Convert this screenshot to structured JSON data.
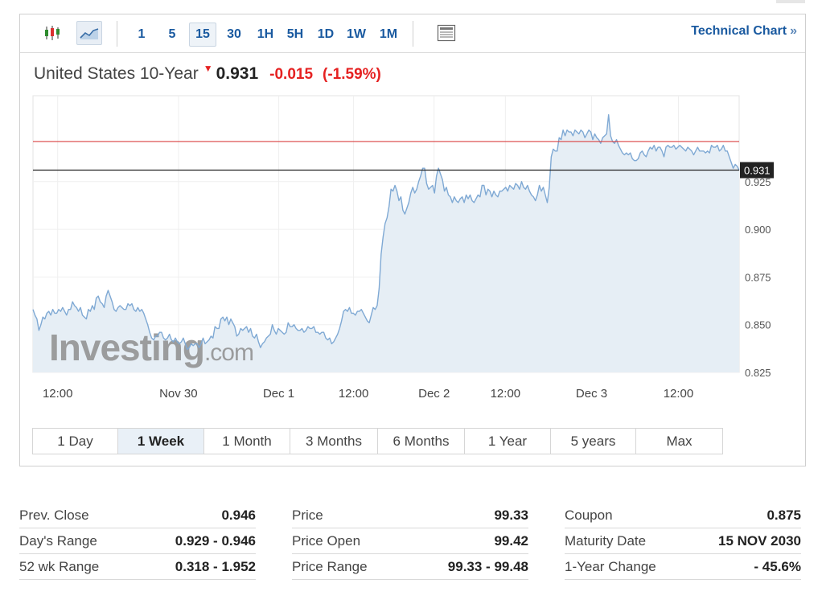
{
  "toolbar": {
    "chart_type_icons": [
      "candlestick-icon",
      "area-chart-icon"
    ],
    "intervals": [
      "1",
      "5",
      "15",
      "30",
      "1H",
      "5H",
      "1D",
      "1W",
      "1M"
    ],
    "active_interval": "15",
    "technical_chart_label": "Technical Chart",
    "technical_chart_arrow": "»"
  },
  "quote": {
    "name": "United States 10-Year",
    "direction_glyph": "▼",
    "last": "0.931",
    "change": "-0.015",
    "change_pct": "(-1.59%)"
  },
  "watermark": {
    "brand": "Investing",
    "suffix": ".com"
  },
  "chart_data": {
    "type": "area",
    "ylim": [
      0.825,
      0.97
    ],
    "y_ticks": [
      "0.825",
      "0.850",
      "0.875",
      "0.900",
      "0.925"
    ],
    "x_tick_labels": [
      "12:00",
      "Nov 30",
      "Dec 1",
      "12:00",
      "Dec 2",
      "12:00",
      "Dec 3",
      "12:00"
    ],
    "x_tick_positions": [
      0.035,
      0.206,
      0.348,
      0.454,
      0.568,
      0.669,
      0.791,
      0.914
    ],
    "prev_close": 0.946,
    "last_price": 0.931,
    "last_price_label": "0.931",
    "line_color": "#7fa9d4",
    "fill_color": "#e6eef5",
    "prev_close_color": "#d94040",
    "last_line_color": "#222222",
    "series": [
      {
        "values": [
          0.858,
          0.855,
          0.853,
          0.847,
          0.85,
          0.854,
          0.853,
          0.856,
          0.857,
          0.855,
          0.858,
          0.856,
          0.856,
          0.858,
          0.857,
          0.859,
          0.857,
          0.855,
          0.858,
          0.858,
          0.862,
          0.86,
          0.859,
          0.857,
          0.859,
          0.855,
          0.854,
          0.853,
          0.858,
          0.857,
          0.86,
          0.858,
          0.864,
          0.865,
          0.862,
          0.861,
          0.859,
          0.865,
          0.868,
          0.865,
          0.862,
          0.858,
          0.857,
          0.859,
          0.86,
          0.859,
          0.858,
          0.858,
          0.861,
          0.86,
          0.861,
          0.858,
          0.857,
          0.859,
          0.857,
          0.858,
          0.856,
          0.853,
          0.85,
          0.846,
          0.843,
          0.842,
          0.844,
          0.844,
          0.846,
          0.846,
          0.843,
          0.842,
          0.843,
          0.845,
          0.842,
          0.841,
          0.843,
          0.841,
          0.84,
          0.841,
          0.843,
          0.84,
          0.837,
          0.838,
          0.84,
          0.839,
          0.84,
          0.84,
          0.838,
          0.84,
          0.843,
          0.84,
          0.841,
          0.842,
          0.844,
          0.843,
          0.849,
          0.848,
          0.848,
          0.853,
          0.854,
          0.852,
          0.854,
          0.85,
          0.853,
          0.851,
          0.849,
          0.844,
          0.845,
          0.848,
          0.847,
          0.848,
          0.849,
          0.846,
          0.848,
          0.844,
          0.843,
          0.845,
          0.841,
          0.838,
          0.84,
          0.841,
          0.843,
          0.844,
          0.845,
          0.85,
          0.847,
          0.845,
          0.848,
          0.847,
          0.846,
          0.845,
          0.846,
          0.851,
          0.849,
          0.849,
          0.85,
          0.848,
          0.847,
          0.847,
          0.848,
          0.846,
          0.847,
          0.849,
          0.848,
          0.848,
          0.849,
          0.846,
          0.846,
          0.845,
          0.846,
          0.846,
          0.843,
          0.842,
          0.843,
          0.84,
          0.841,
          0.843,
          0.845,
          0.848,
          0.852,
          0.857,
          0.858,
          0.857,
          0.859,
          0.856,
          0.856,
          0.855,
          0.857,
          0.857,
          0.858,
          0.856,
          0.854,
          0.852,
          0.851,
          0.855,
          0.859,
          0.858,
          0.86,
          0.869,
          0.887,
          0.896,
          0.903,
          0.906,
          0.912,
          0.921,
          0.92,
          0.923,
          0.92,
          0.915,
          0.917,
          0.91,
          0.908,
          0.911,
          0.914,
          0.919,
          0.922,
          0.919,
          0.921,
          0.925,
          0.928,
          0.932,
          0.932,
          0.924,
          0.921,
          0.922,
          0.923,
          0.919,
          0.928,
          0.932,
          0.929,
          0.926,
          0.92,
          0.922,
          0.918,
          0.917,
          0.914,
          0.917,
          0.915,
          0.914,
          0.916,
          0.917,
          0.914,
          0.918,
          0.916,
          0.918,
          0.915,
          0.914,
          0.916,
          0.918,
          0.917,
          0.923,
          0.923,
          0.918,
          0.921,
          0.92,
          0.917,
          0.92,
          0.918,
          0.917,
          0.92,
          0.92,
          0.921,
          0.922,
          0.92,
          0.923,
          0.922,
          0.921,
          0.924,
          0.923,
          0.921,
          0.925,
          0.922,
          0.921,
          0.923,
          0.92,
          0.918,
          0.917,
          0.915,
          0.918,
          0.923,
          0.92,
          0.922,
          0.918,
          0.914,
          0.922,
          0.938,
          0.942,
          0.941,
          0.941,
          0.948,
          0.947,
          0.952,
          0.949,
          0.952,
          0.951,
          0.951,
          0.949,
          0.952,
          0.951,
          0.95,
          0.952,
          0.951,
          0.948,
          0.95,
          0.952,
          0.951,
          0.947,
          0.95,
          0.948,
          0.947,
          0.945,
          0.948,
          0.949,
          0.95,
          0.96,
          0.949,
          0.946,
          0.945,
          0.947,
          0.944,
          0.942,
          0.94,
          0.939,
          0.94,
          0.939,
          0.94,
          0.937,
          0.936,
          0.936,
          0.937,
          0.94,
          0.941,
          0.939,
          0.938,
          0.941,
          0.943,
          0.942,
          0.944,
          0.941,
          0.943,
          0.943,
          0.941,
          0.938,
          0.943,
          0.944,
          0.943,
          0.943,
          0.944,
          0.942,
          0.943,
          0.944,
          0.943,
          0.942,
          0.941,
          0.943,
          0.942,
          0.941,
          0.939,
          0.941,
          0.943,
          0.941,
          0.941,
          0.941,
          0.94,
          0.941,
          0.94,
          0.944,
          0.943,
          0.943,
          0.944,
          0.941,
          0.942,
          0.944,
          0.941,
          0.941,
          0.938,
          0.935,
          0.932,
          0.934,
          0.933,
          0.931
        ]
      }
    ]
  },
  "ranges": {
    "items": [
      "1 Day",
      "1 Week",
      "1 Month",
      "3 Months",
      "6 Months",
      "1 Year",
      "5 years",
      "Max"
    ],
    "active": "1 Week"
  },
  "stats": {
    "col1": [
      {
        "label": "Prev. Close",
        "value": "0.946"
      },
      {
        "label": "Day's Range",
        "value": "0.929 - 0.946"
      },
      {
        "label": "52 wk Range",
        "value": "0.318 - 1.952"
      }
    ],
    "col2": [
      {
        "label": "Price",
        "value": "99.33"
      },
      {
        "label": "Price Open",
        "value": "99.42"
      },
      {
        "label": "Price Range",
        "value": "99.33 - 99.48"
      }
    ],
    "col3": [
      {
        "label": "Coupon",
        "value": "0.875"
      },
      {
        "label": "Maturity Date",
        "value": "15 NOV 2030"
      },
      {
        "label": "1-Year Change",
        "value": "- 45.6%"
      }
    ]
  }
}
